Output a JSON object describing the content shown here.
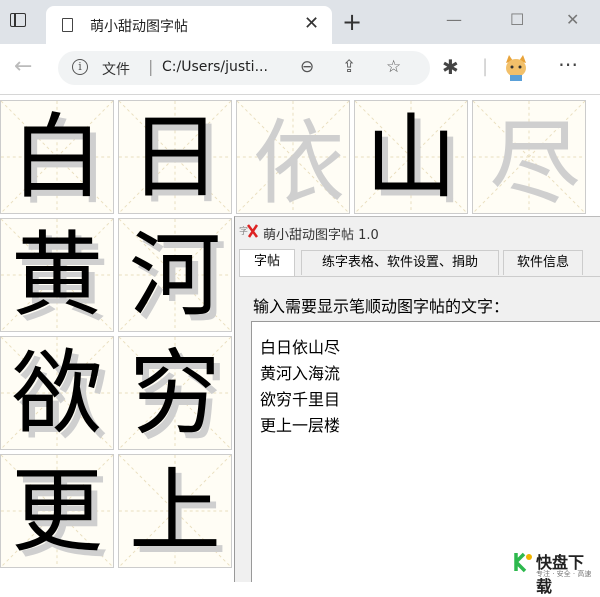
{
  "browser": {
    "tab_title": "萌小甜动图字帖",
    "address_label": "文件",
    "address_sep": "|",
    "url": "C:/Users/justi..."
  },
  "grid": [
    {
      "char": "白",
      "ghost": false
    },
    {
      "char": "日",
      "ghost": false
    },
    {
      "char": "依",
      "ghost": true
    },
    {
      "char": "山",
      "ghost": false
    },
    {
      "char": "尽",
      "ghost": true
    },
    {
      "char": "黄",
      "ghost": false
    },
    {
      "char": "河",
      "ghost": false
    },
    {
      "char": "欲",
      "ghost": false
    },
    {
      "char": "穷",
      "ghost": false
    },
    {
      "char": "更",
      "ghost": false
    },
    {
      "char": "上",
      "ghost": false
    }
  ],
  "app": {
    "title": "萌小甜动图字帖 1.0",
    "tabs": [
      "字帖",
      "练字表格、软件设置、捐助",
      "软件信息"
    ],
    "prompt": "输入需要显示笔顺动图字帖的文字：",
    "lines": [
      "白日依山尽",
      "黄河入海流",
      "欲穷千里目",
      "更上一层楼"
    ]
  },
  "watermark": {
    "name": "快盘下载",
    "sub": "专注 · 安全 · 高速",
    "accent": "#2db84d"
  }
}
